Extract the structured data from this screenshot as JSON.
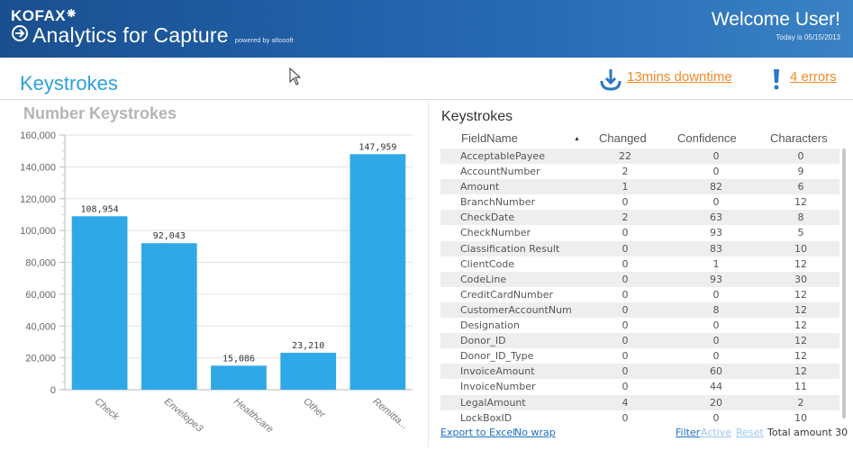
{
  "header": {
    "brand": "KOFAX",
    "app_title": "Analytics for Capture",
    "powered_by": "powered by altosoft",
    "welcome": "Welcome User!",
    "today": "Today is 05/15/2013"
  },
  "page": {
    "title": "Keystrokes",
    "downtime_link": "13mins downtime",
    "errors_link": "4 errors"
  },
  "chart_data": {
    "type": "bar",
    "title": "Number Keystrokes",
    "categories": [
      "Check",
      "Envelope3",
      "Healthcare",
      "Other",
      "Remitta..."
    ],
    "values": [
      108954,
      92043,
      15086,
      23210,
      147959
    ],
    "value_labels": [
      "108,954",
      "92,043",
      "15,086",
      "23,210",
      "147,959"
    ],
    "y_ticks": [
      "0",
      "20,000",
      "40,000",
      "60,000",
      "80,000",
      "100,000",
      "120,000",
      "140,000",
      "160,000"
    ],
    "ylim": [
      0,
      160000
    ],
    "bar_color": "#2fa8e8",
    "grid": true
  },
  "table": {
    "title": "Keystrokes",
    "columns": [
      "FieldName",
      "Changed",
      "Confidence",
      "Characters"
    ],
    "sort_indicator": "▲",
    "rows": [
      {
        "name": "AcceptablePayee",
        "changed": "22",
        "confidence": "0",
        "characters": "0"
      },
      {
        "name": "AccountNumber",
        "changed": "2",
        "confidence": "0",
        "characters": "9"
      },
      {
        "name": "Amount",
        "changed": "1",
        "confidence": "82",
        "characters": "6"
      },
      {
        "name": "BranchNumber",
        "changed": "0",
        "confidence": "0",
        "characters": "12"
      },
      {
        "name": "CheckDate",
        "changed": "2",
        "confidence": "63",
        "characters": "8"
      },
      {
        "name": "CheckNumber",
        "changed": "0",
        "confidence": "93",
        "characters": "5"
      },
      {
        "name": "Classification Result",
        "changed": "0",
        "confidence": "83",
        "characters": "10"
      },
      {
        "name": "ClientCode",
        "changed": "0",
        "confidence": "1",
        "characters": "12"
      },
      {
        "name": "CodeLine",
        "changed": "0",
        "confidence": "93",
        "characters": "30"
      },
      {
        "name": "CreditCardNumber",
        "changed": "0",
        "confidence": "0",
        "characters": "12"
      },
      {
        "name": "CustomerAccountNum",
        "changed": "0",
        "confidence": "8",
        "characters": "12"
      },
      {
        "name": "Designation",
        "changed": "0",
        "confidence": "0",
        "characters": "12"
      },
      {
        "name": "Donor_ID",
        "changed": "0",
        "confidence": "0",
        "characters": "12"
      },
      {
        "name": "Donor_ID_Type",
        "changed": "0",
        "confidence": "0",
        "characters": "12"
      },
      {
        "name": "InvoiceAmount",
        "changed": "0",
        "confidence": "60",
        "characters": "12"
      },
      {
        "name": "InvoiceNumber",
        "changed": "0",
        "confidence": "44",
        "characters": "11"
      },
      {
        "name": "LegalAmount",
        "changed": "4",
        "confidence": "20",
        "characters": "2"
      },
      {
        "name": "LockBoxID",
        "changed": "0",
        "confidence": "0",
        "characters": "10"
      }
    ]
  },
  "footer": {
    "export_label": "Export to Excel",
    "nowrap_label": "No wrap",
    "filter_label": "Filter",
    "active_label": "Active",
    "reset_label": "Reset",
    "total_label": "Total amount 30"
  },
  "colors": {
    "accent": "#2aa0dc",
    "link_orange": "#f08a24",
    "header_blue": "#1f5ea3"
  }
}
